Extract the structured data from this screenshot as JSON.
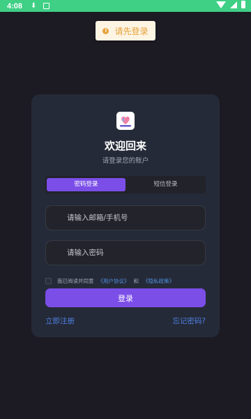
{
  "status_bar": {
    "time": "4:08"
  },
  "toast": {
    "icon": "warning-icon",
    "text": "请先登录"
  },
  "login": {
    "title": "欢迎回来",
    "subtitle": "请登录您的账户",
    "tabs": [
      {
        "label": "密码登录",
        "active": true
      },
      {
        "label": "短信登录",
        "active": false
      }
    ],
    "email_placeholder": "请输入邮箱/手机号",
    "password_placeholder": "请输入密码",
    "agreement": {
      "prefix": "我已阅读并同意",
      "user_agreement": "《用户协议》",
      "and": "和",
      "privacy_policy": "《隐私政策》"
    },
    "login_button": "登录",
    "register_link": "立即注册",
    "forgot_link": "忘记密码?"
  },
  "colors": {
    "background": "#1c1a22",
    "card": "#252a38",
    "accent": "#7b4ee8",
    "link": "#4d7fe0",
    "status_bar": "#3fcf85",
    "toast_text": "#e6a23c"
  }
}
